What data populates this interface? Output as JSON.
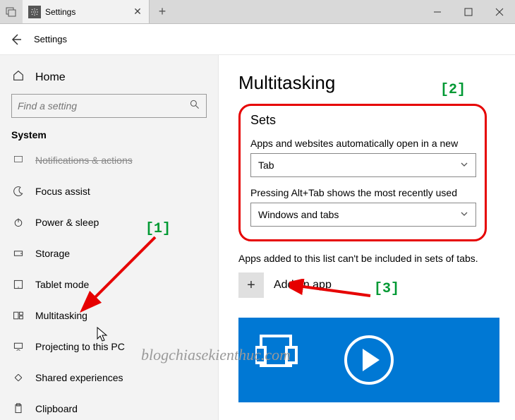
{
  "tabbar": {
    "tab_title": "Settings",
    "close_glyph": "✕",
    "new_tab_glyph": "+"
  },
  "header": {
    "title": "Settings"
  },
  "sidebar": {
    "home_label": "Home",
    "search_placeholder": "Find a setting",
    "section_label": "System",
    "items": [
      {
        "label": "Notifications & actions"
      },
      {
        "label": "Focus assist"
      },
      {
        "label": "Power & sleep"
      },
      {
        "label": "Storage"
      },
      {
        "label": "Tablet mode"
      },
      {
        "label": "Multitasking"
      },
      {
        "label": "Projecting to this PC"
      },
      {
        "label": "Shared experiences"
      },
      {
        "label": "Clipboard"
      }
    ],
    "selected_index": 5
  },
  "content": {
    "page_title": "Multitasking",
    "sets": {
      "heading": "Sets",
      "field1_label": "Apps and websites automatically open in a new",
      "field1_value": "Tab",
      "field2_label": "Pressing Alt+Tab shows the most recently used",
      "field2_value": "Windows and tabs"
    },
    "list_note": "Apps added to this list can't be included in sets of tabs.",
    "add_app_label": "Add an app"
  },
  "annotations": {
    "a1": "[1]",
    "a2": "[2]",
    "a3": "[3]"
  },
  "watermark": "blogchiasekienthuc.com"
}
